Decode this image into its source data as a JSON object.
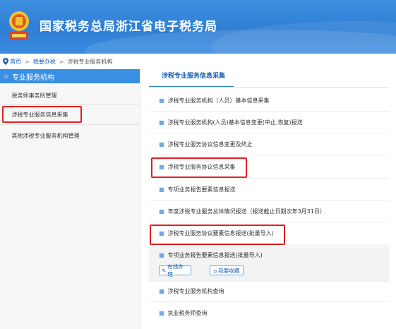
{
  "header": {
    "site_title": "国家税务总局浙江省电子税务局",
    "brand_color": "#2f7fd5"
  },
  "breadcrumb": {
    "home": "首页",
    "sep1": ">",
    "office": "我要办税",
    "sep2": ">",
    "current": "涉税专业服务机构"
  },
  "sidebar": {
    "title": "专业服务机构",
    "items": [
      {
        "label": "税务师事务所管理"
      },
      {
        "label": "涉税专业服务信息采集",
        "active": true
      },
      {
        "label": "其他涉税专业服务机构管理"
      }
    ]
  },
  "main": {
    "tab_label": "涉税专业服务信息采集",
    "rows": [
      {
        "label": "涉税专业服务机构（人员）基本信息采集"
      },
      {
        "label": "涉税专业服务机构(人员)基本信息变更(中止,恢复)报送"
      },
      {
        "label": "涉税专业服务协议信息变更及终止"
      },
      {
        "label": "涉税专业服务协议信息采集",
        "highlighted": true
      },
      {
        "label": "专项业务报告要素信息报送"
      },
      {
        "label": "年度涉税专业服务总体情况报送（报送截止日期次年3月31日）"
      },
      {
        "label": "涉税专业服务协议要素信息报送(批量导入)",
        "highlighted": true
      },
      {
        "label": "专项业务报告要素信息报送(批量导入)",
        "expanded": true
      },
      {
        "label": "涉税专业服务机构查询"
      },
      {
        "label": "执业税务师查询"
      }
    ],
    "actions": {
      "online": "在线办理",
      "favorite": "我要收藏"
    }
  },
  "colors": {
    "highlight": "#e02020",
    "sidebar_head": "#3b8fe3",
    "link": "#1a5fb4"
  }
}
